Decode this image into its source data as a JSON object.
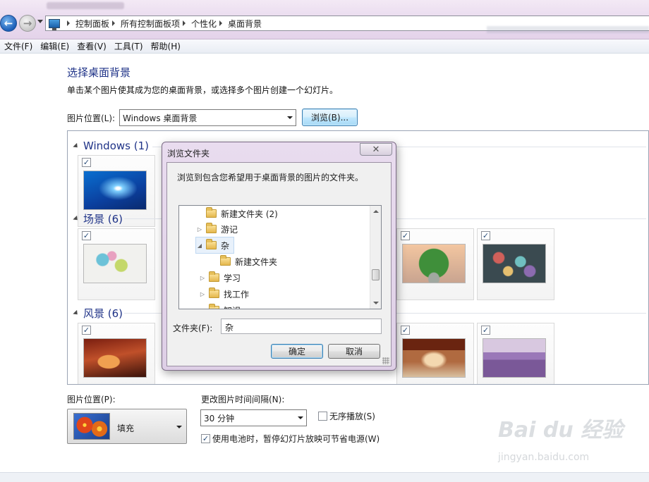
{
  "address": {
    "breadcrumbs": [
      "控制面板",
      "所有控制面板项",
      "个性化",
      "桌面背景"
    ]
  },
  "menu": {
    "items": [
      "文件(F)",
      "编辑(E)",
      "查看(V)",
      "工具(T)",
      "帮助(H)"
    ]
  },
  "main": {
    "title": "选择桌面背景",
    "description": "单击某个图片使其成为您的桌面背景，或选择多个图片创建一个幻灯片。",
    "picture_location_label": "图片位置(L):",
    "picture_location_value": "Windows 桌面背景",
    "browse_label": "浏览(B)..."
  },
  "groups": [
    {
      "label": "Windows (1)"
    },
    {
      "label": "场景 (6)"
    },
    {
      "label": "风景 (6)"
    }
  ],
  "bottom": {
    "position_label": "图片位置(P):",
    "position_value": "填充",
    "interval_label": "更改图片时间间隔(N):",
    "interval_value": "30 分钟",
    "shuffle_label": "无序播放(S)",
    "shuffle_checked": false,
    "battery_label": "使用电池时，暂停幻灯片放映可节省电源(W)",
    "battery_checked": true
  },
  "dialog": {
    "title": "浏览文件夹",
    "description": "浏览到包含您希望用于桌面背景的图片的文件夹。",
    "tree": [
      {
        "label": "新建文件夹 (2)"
      },
      {
        "label": "游记"
      },
      {
        "label": "杂"
      },
      {
        "label": "新建文件夹"
      },
      {
        "label": "学习"
      },
      {
        "label": "找工作"
      },
      {
        "label": "知识"
      }
    ],
    "folder_label": "文件夹(F):",
    "folder_value": "杂",
    "ok_label": "确定",
    "cancel_label": "取消"
  },
  "watermark": {
    "brand": "Bai du 经验",
    "url": "jingyan.baidu.com"
  },
  "colors": {
    "heading_blue": "#1e3287",
    "dialog_frame": "#e4d3ea",
    "accent_button": "#3c7fb1"
  }
}
